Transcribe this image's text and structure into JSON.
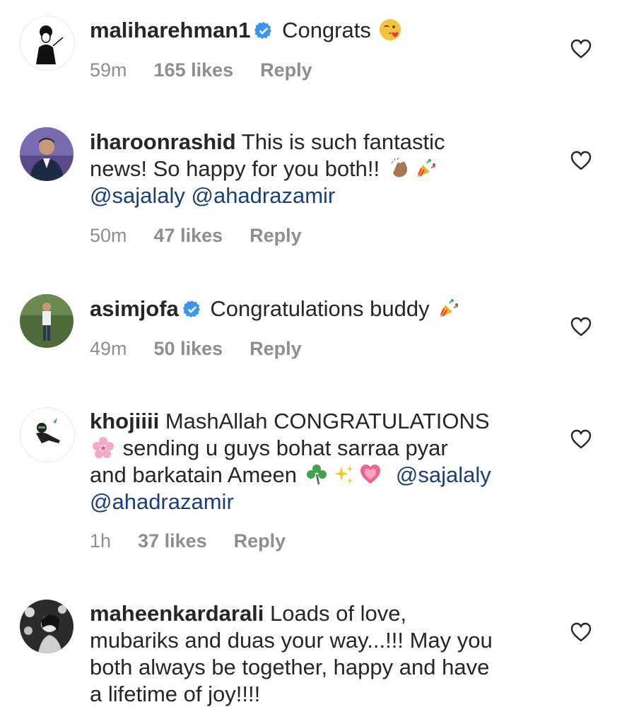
{
  "comments": [
    {
      "username": "maliharehman1",
      "verified": true,
      "text": "Congrats",
      "emoji": [
        "face-blowing-kiss-emoji"
      ],
      "time": "59m",
      "likes": "165 likes",
      "reply": "Reply"
    },
    {
      "username": "iharoonrashid",
      "verified": false,
      "text_line1": "This is such fantastic",
      "text_line2": "news! So happy for you both!!",
      "emoji": [
        "clapping-hands-emoji",
        "party-popper-emoji"
      ],
      "mention1": "@sajalaly",
      "mention2": "@ahadrazamir",
      "time": "50m",
      "likes": "47 likes",
      "reply": "Reply"
    },
    {
      "username": "asimjofa",
      "verified": true,
      "text": "Congratulations buddy",
      "emoji": [
        "party-popper-emoji"
      ],
      "time": "49m",
      "likes": "50 likes",
      "reply": "Reply"
    },
    {
      "username": "khojiiii",
      "verified": false,
      "text_line1": "MashAllah CONGRATULATIONS",
      "text_line2": "sending u guys bohat sarraa pyar",
      "text_line3": "and barkatain Ameen",
      "emoji": [
        "cherry-blossom-emoji",
        "shamrock-emoji",
        "sparkles-emoji",
        "growing-heart-emoji"
      ],
      "mention1": "@sajalaly",
      "mention2": "@ahadrazamir",
      "time": "1h",
      "likes": "37 likes",
      "reply": "Reply"
    },
    {
      "username": "maheenkardarali",
      "verified": false,
      "text_line1": "Loads of love,",
      "text_line2": "mubariks and duas your way...!!! May you",
      "text_line3": "both always be together, happy and have",
      "text_line4": "a lifetime of joy!!!!"
    }
  ],
  "colors": {
    "text": "#262626",
    "meta": "#8e8e8e",
    "mention": "#1b3f7a",
    "verified": "#3897f0"
  },
  "icons": {
    "like": "heart-outline-icon",
    "verified": "verified-badge-icon"
  }
}
